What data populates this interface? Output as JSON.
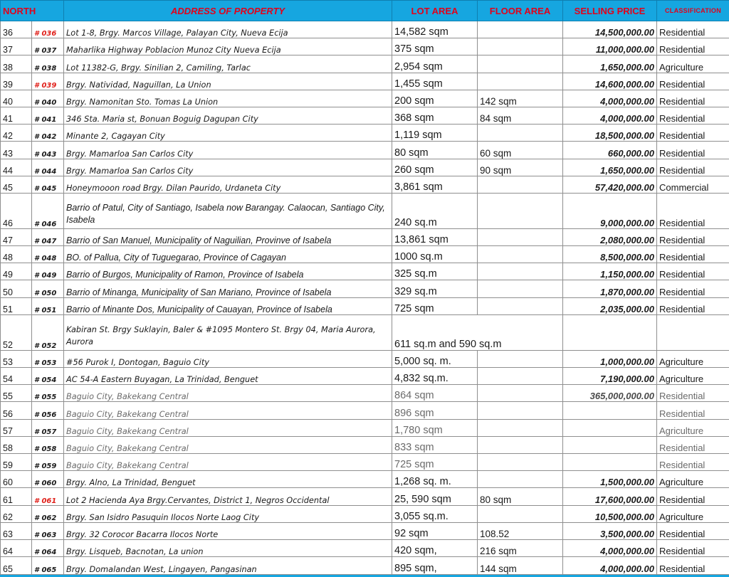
{
  "colors": {
    "header_bg": "#16a6e0",
    "header_text": "#e2001a",
    "code_red": "#e0201a"
  },
  "header": {
    "north": "NORTH",
    "address": "ADDRESS OF PROPERTY",
    "lot_area": "LOT AREA",
    "floor_area": "FLOOR AREA",
    "selling_price": "SELLING PRICE",
    "classification": "CLASSIFICATION"
  },
  "rows": [
    {
      "no": "36",
      "code": "# 036",
      "address": "Lot 1-8, Brgy. Marcos Village, Palayan City, Nueva Ecija",
      "lot_area": "14,582 sqm",
      "floor_area": "",
      "price": "14,500,000.00",
      "classification": "Residential"
    },
    {
      "no": "37",
      "code": "# 037",
      "address": "Maharlika Highway Poblacion Munoz City Nueva Ecija",
      "lot_area": "375 sqm",
      "floor_area": "",
      "price": "11,000,000.00",
      "classification": "Residential"
    },
    {
      "no": "38",
      "code": "# 038",
      "address": "Lot 11382-G, Brgy. Sinilian 2, Camiling, Tarlac",
      "lot_area": "2,954 sqm",
      "floor_area": "",
      "price": "1,650,000.00",
      "classification": "Agriculture"
    },
    {
      "no": "39",
      "code": "# 039",
      "address": "Brgy. Natividad, Naguillan, La Union",
      "lot_area": "1,455 sqm",
      "floor_area": "",
      "price": "14,600,000.00",
      "classification": "Residential"
    },
    {
      "no": "40",
      "code": "# 040",
      "address": "Brgy. Namonitan Sto. Tomas La Union",
      "lot_area": "200 sqm",
      "floor_area": "142 sqm",
      "price": "4,000,000.00",
      "classification": "Residential"
    },
    {
      "no": "41",
      "code": "# 041",
      "address": "346 Sta. Maria st, Bonuan Boguig Dagupan City",
      "lot_area": "368 sqm",
      "floor_area": "84 sqm",
      "price": "4,000,000.00",
      "classification": "Residential"
    },
    {
      "no": "42",
      "code": "# 042",
      "address": "Minante 2, Cagayan City",
      "lot_area": "1,119 sqm",
      "floor_area": "",
      "price": "18,500,000.00",
      "classification": "Residential"
    },
    {
      "no": "43",
      "code": "# 043",
      "address": "Brgy. Mamarloa San Carlos City",
      "lot_area": "80 sqm",
      "floor_area": "60 sqm",
      "price": "660,000.00",
      "classification": "Residential"
    },
    {
      "no": "44",
      "code": "# 044",
      "address": "Brgy. Mamarloa San Carlos City",
      "lot_area": "260 sqm",
      "floor_area": "90 sqm",
      "price": "1,650,000.00",
      "classification": "Residential"
    },
    {
      "no": "45",
      "code": "# 045",
      "address": "Honeymooon road Brgy. Dilan Paurido, Urdaneta City",
      "lot_area": "3,861 sqm",
      "floor_area": "",
      "price": "57,420,000.00",
      "classification": "Commercial"
    },
    {
      "no": "46",
      "code": "# 046",
      "address": "Barrio of Patul, City of Santiago, Isabela now Barangay. Calaocan, Santiago City, Isabela",
      "lot_area": "240 sq.m",
      "floor_area": "",
      "price": "9,000,000.00",
      "classification": "Residential"
    },
    {
      "no": "47",
      "code": "# 047",
      "address": "Barrio of San Manuel, Municipality of Naguilian, Provinve of Isabela",
      "lot_area": "13,861 sqm",
      "floor_area": "",
      "price": "2,080,000.00",
      "classification": "Residential"
    },
    {
      "no": "48",
      "code": "# 048",
      "address": "BO. of Pallua, City of Tuguegarao, Province of Cagayan",
      "lot_area": "1000 sq.m",
      "floor_area": "",
      "price": "8,500,000.00",
      "classification": "Residential"
    },
    {
      "no": "49",
      "code": "# 049",
      "address": "Barrio of Burgos, Municipality of Ramon, Province of Isabela",
      "lot_area": "325 sq.m",
      "floor_area": "",
      "price": "1,150,000.00",
      "classification": "Residential"
    },
    {
      "no": "50",
      "code": "# 050",
      "address": "Barrio of Minanga, Municipality of San Mariano, Province of Isabela",
      "lot_area": "329 sq.m",
      "floor_area": "",
      "price": "1,870,000.00",
      "classification": "Residential"
    },
    {
      "no": "51",
      "code": "# 051",
      "address": "Barrio of Minante Dos, Municipality of Cauayan, Province of Isabela",
      "lot_area": "725 sqm",
      "floor_area": "",
      "price": "2,035,000.00",
      "classification": "Residential"
    },
    {
      "no": "52",
      "code": "# 052",
      "address": "Kabiran St. Brgy Suklayin, Baler & #1095 Montero St. Brgy 04, Maria Aurora, Aurora",
      "lot_area": "611 sq.m and 590 sq.m",
      "floor_area": "",
      "price": "",
      "classification": ""
    },
    {
      "no": "53",
      "code": "# 053",
      "address": "#56 Purok I, Dontogan, Baguio City",
      "lot_area": "5,000 sq. m.",
      "floor_area": "",
      "price": "1,000,000.00",
      "classification": "Agriculture"
    },
    {
      "no": "54",
      "code": "# 054",
      "address": "AC 54-A Eastern Buyagan, La Trinidad, Benguet",
      "lot_area": "4,832 sq.m.",
      "floor_area": "",
      "price": "7,190,000.00",
      "classification": "Agriculture"
    },
    {
      "no": "55",
      "code": "# 055",
      "address": "Baguio City, Bakekang Central",
      "lot_area": "864 sqm",
      "floor_area": "",
      "price": "365,000,000.00",
      "classification": "Residential"
    },
    {
      "no": "56",
      "code": "# 056",
      "address": "Baguio City, Bakekang Central",
      "lot_area": "896 sqm",
      "floor_area": "",
      "price": "",
      "classification": "Residential"
    },
    {
      "no": "57",
      "code": "# 057",
      "address": "Baguio City, Bakekang Central",
      "lot_area": "1,780 sqm",
      "floor_area": "",
      "price": "",
      "classification": "Agriculture"
    },
    {
      "no": "58",
      "code": "# 058",
      "address": "Baguio City, Bakekang Central",
      "lot_area": "833 sqm",
      "floor_area": "",
      "price": "",
      "classification": "Residential"
    },
    {
      "no": "59",
      "code": "# 059",
      "address": "Baguio City, Bakekang Central",
      "lot_area": "725 sqm",
      "floor_area": "",
      "price": "",
      "classification": "Residential"
    },
    {
      "no": "60",
      "code": "# 060",
      "address": "Brgy. Alno, La Trinidad, Benguet",
      "lot_area": "1,268 sq. m.",
      "floor_area": "",
      "price": "1,500,000.00",
      "classification": "Agriculture"
    },
    {
      "no": "61",
      "code": "# 061",
      "address": "Lot 2 Hacienda Aya Brgy.Cervantes, District 1, Negros Occidental",
      "lot_area": "25, 590 sqm",
      "floor_area": "80 sqm",
      "price": "17,600,000.00",
      "classification": "Residential"
    },
    {
      "no": "62",
      "code": "# 062",
      "address": "Brgy. San Isidro Pasuquin Ilocos Norte Laog City",
      "lot_area": "3,055 sq.m.",
      "floor_area": "",
      "price": "10,500,000.00",
      "classification": "Agriculture"
    },
    {
      "no": "63",
      "code": "# 063",
      "address": "Brgy. 32 Corocor Bacarra Ilocos Norte",
      "lot_area": "92 sqm",
      "floor_area": "108.52",
      "price": "3,500,000.00",
      "classification": "Residential"
    },
    {
      "no": "64",
      "code": "# 064",
      "address": "Brgy. Lisqueb, Bacnotan, La union",
      "lot_area": "420 sqm,",
      "floor_area": "216 sqm",
      "price": "4,000,000.00",
      "classification": "Residential"
    },
    {
      "no": "65",
      "code": "# 065",
      "address": "Brgy. Domalandan West, Lingayen, Pangasinan",
      "lot_area": "895 sqm,",
      "floor_area": "144 sqm",
      "price": "4,000,000.00",
      "classification": "Residential"
    }
  ]
}
